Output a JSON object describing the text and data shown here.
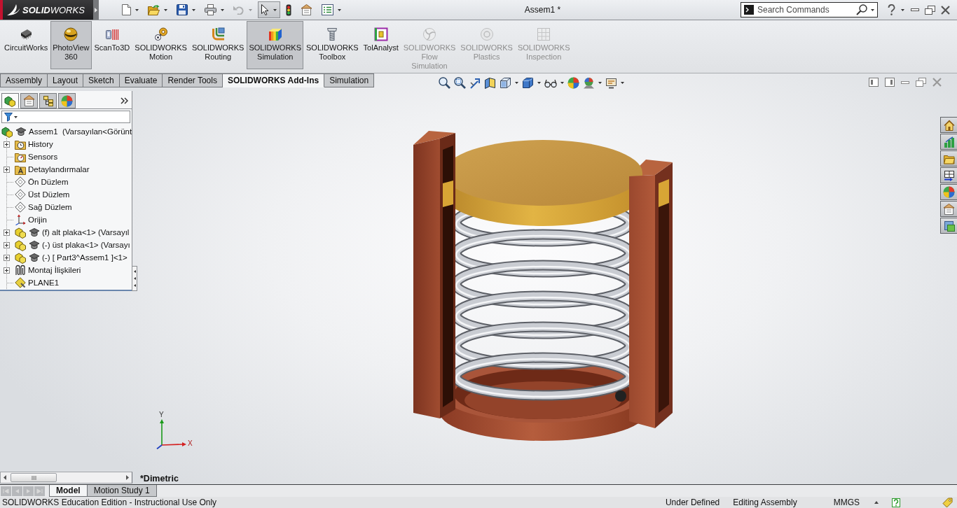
{
  "title_bar": {
    "logo": "**SOLID**WORKS",
    "quick_access": [
      {
        "selected": false,
        "disabled": false,
        "dropdown": true
      },
      {
        "selected": false,
        "disabled": false,
        "dropdown": true
      },
      {
        "selected": false,
        "disabled": false,
        "dropdown": true
      },
      {
        "selected": false,
        "disabled": false,
        "dropdown": true
      },
      {
        "selected": false,
        "disabled": true,
        "dropdown": true
      },
      {
        "selected": true,
        "disabled": false,
        "dropdown": true
      },
      {
        "selected": false,
        "disabled": false,
        "dropdown": false
      },
      {
        "selected": false,
        "disabled": false,
        "dropdown": false
      },
      {
        "selected": false,
        "disabled": false,
        "dropdown": true
      }
    ],
    "title": "Assem1 *",
    "search": {
      "placeholder": "Search Commands"
    }
  },
  "command_manager": {
    "items": [
      {
        "lines": [
          "CircuitWorks"
        ],
        "selected": false,
        "disabled": false
      },
      {
        "lines": [
          "PhotoView",
          "360"
        ],
        "selected": true,
        "disabled": false
      },
      {
        "lines": [
          "ScanTo3D"
        ],
        "selected": false,
        "disabled": false
      },
      {
        "lines": [
          "SOLIDWORKS",
          "Motion"
        ],
        "selected": false,
        "disabled": false
      },
      {
        "lines": [
          "SOLIDWORKS",
          "Routing"
        ],
        "selected": false,
        "disabled": false
      },
      {
        "lines": [
          "SOLIDWORKS",
          "Simulation"
        ],
        "selected": true,
        "disabled": false
      },
      {
        "lines": [
          "SOLIDWORKS",
          "Toolbox"
        ],
        "selected": false,
        "disabled": false
      },
      {
        "lines": [
          "TolAnalyst"
        ],
        "selected": false,
        "disabled": false
      },
      {
        "lines": [
          "SOLIDWORKS",
          "Flow",
          "Simulation"
        ],
        "selected": false,
        "disabled": true
      },
      {
        "lines": [
          "SOLIDWORKS",
          "Plastics"
        ],
        "selected": false,
        "disabled": true
      },
      {
        "lines": [
          "SOLIDWORKS",
          "Inspection"
        ],
        "selected": false,
        "disabled": true
      }
    ],
    "tabs": [
      {
        "label": "Assembly",
        "selected": false
      },
      {
        "label": "Layout",
        "selected": false
      },
      {
        "label": "Sketch",
        "selected": false
      },
      {
        "label": "Evaluate",
        "selected": false
      },
      {
        "label": "Render Tools",
        "selected": false
      },
      {
        "label": "SOLIDWORKS Add-Ins",
        "selected": true
      },
      {
        "label": "Simulation",
        "selected": false
      }
    ]
  },
  "feature_manager": {
    "tabs": [
      {
        "selected": true
      },
      {
        "selected": false
      },
      {
        "selected": false
      },
      {
        "selected": false
      }
    ],
    "tree": [
      {
        "label": "Assem1  (Varsayılan<Görünt",
        "kind": "assembly",
        "expandable": false,
        "children": [
          {
            "label": "History",
            "kind": "history",
            "expandable": true
          },
          {
            "label": "Sensors",
            "kind": "sensors",
            "expandable": false
          },
          {
            "label": "Detaylandırmalar",
            "kind": "annotations",
            "expandable": true
          },
          {
            "label": "Ön Düzlem",
            "kind": "plane",
            "expandable": false
          },
          {
            "label": "Üst Düzlem",
            "kind": "plane",
            "expandable": false
          },
          {
            "label": "Sağ Düzlem",
            "kind": "plane",
            "expandable": false
          },
          {
            "label": "Orijin",
            "kind": "origin",
            "expandable": false
          },
          {
            "label": "(f) alt plaka<1> (Varsayıl",
            "kind": "component",
            "expandable": true
          },
          {
            "label": "(-) üst plaka<1> (Varsayı",
            "kind": "component",
            "expandable": true
          },
          {
            "label": "(-) [ Part3^Assem1 ]<1>",
            "kind": "component",
            "expandable": true
          },
          {
            "label": "Montaj İlişkileri",
            "kind": "mates",
            "expandable": true
          },
          {
            "label": "PLANE1",
            "kind": "feature",
            "expandable": false
          }
        ]
      }
    ]
  },
  "viewport": {
    "triad": {
      "y_label": "Y",
      "x_label": "X"
    },
    "view_name": "*Dimetric"
  },
  "bottom_tabs": [
    {
      "label": "Model",
      "selected": true
    },
    {
      "label": "Motion Study 1",
      "selected": false
    }
  ],
  "status_bar": {
    "message": "SOLIDWORKS Education Edition - Instructional Use Only",
    "items": [
      "Under Defined",
      "Editing Assembly",
      "MMGS"
    ]
  }
}
